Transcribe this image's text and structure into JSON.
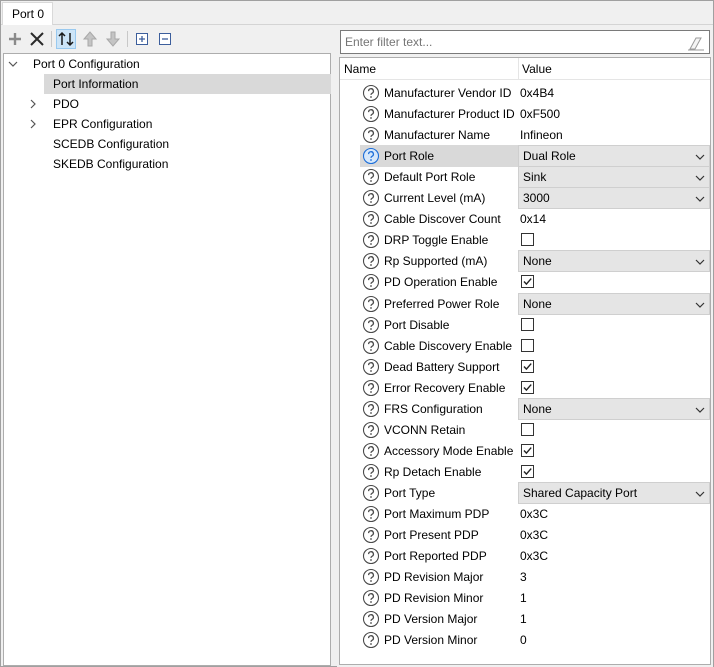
{
  "tab": {
    "label": "Port 0"
  },
  "toolbar": {
    "icons": [
      "add-icon",
      "remove-icon",
      "sort-icon",
      "move-up-icon",
      "move-down-icon",
      "expand-all-icon",
      "collapse-all-icon"
    ]
  },
  "tree": {
    "root": "Port 0 Configuration",
    "items": [
      {
        "label": "Port Information",
        "selected": true,
        "expandable": false
      },
      {
        "label": "PDO",
        "selected": false,
        "expandable": true
      },
      {
        "label": "EPR Configuration",
        "selected": false,
        "expandable": true
      },
      {
        "label": "SCEDB Configuration",
        "selected": false,
        "expandable": false
      },
      {
        "label": "SKEDB Configuration",
        "selected": false,
        "expandable": false
      }
    ]
  },
  "filter": {
    "placeholder": "Enter filter text..."
  },
  "grid": {
    "headers": {
      "name": "Name",
      "value": "Value"
    },
    "rows": [
      {
        "name": "Manufacturer Vendor ID",
        "type": "text",
        "value": "0x4B4"
      },
      {
        "name": "Manufacturer Product ID",
        "type": "text",
        "value": "0xF500"
      },
      {
        "name": "Manufacturer Name",
        "type": "text",
        "value": "Infineon"
      },
      {
        "name": "Port Role",
        "type": "combo",
        "value": "Dual Role",
        "selected": true
      },
      {
        "name": "Default Port Role",
        "type": "combo",
        "value": "Sink"
      },
      {
        "name": "Current Level (mA)",
        "type": "combo",
        "value": "3000"
      },
      {
        "name": "Cable Discover Count",
        "type": "text",
        "value": "0x14"
      },
      {
        "name": "DRP Toggle Enable",
        "type": "check",
        "checked": false
      },
      {
        "name": "Rp Supported (mA)",
        "type": "combo",
        "value": "None"
      },
      {
        "name": "PD Operation Enable",
        "type": "check",
        "checked": true
      },
      {
        "name": "Preferred Power Role",
        "type": "combo",
        "value": "None"
      },
      {
        "name": "Port Disable",
        "type": "check",
        "checked": false
      },
      {
        "name": "Cable Discovery Enable",
        "type": "check",
        "checked": false
      },
      {
        "name": "Dead Battery Support",
        "type": "check",
        "checked": true
      },
      {
        "name": "Error Recovery Enable",
        "type": "check",
        "checked": true
      },
      {
        "name": "FRS Configuration",
        "type": "combo",
        "value": "None"
      },
      {
        "name": "VCONN Retain",
        "type": "check",
        "checked": false
      },
      {
        "name": "Accessory Mode Enable",
        "type": "check",
        "checked": true
      },
      {
        "name": "Rp Detach Enable",
        "type": "check",
        "checked": true
      },
      {
        "name": "Port Type",
        "type": "combo",
        "value": "Shared Capacity Port"
      },
      {
        "name": "Port Maximum PDP",
        "type": "text",
        "value": "0x3C"
      },
      {
        "name": "Port Present PDP",
        "type": "text",
        "value": "0x3C"
      },
      {
        "name": "Port Reported PDP",
        "type": "text",
        "value": "0x3C"
      },
      {
        "name": "PD Revision Major",
        "type": "text",
        "value": "3"
      },
      {
        "name": "PD Revision Minor",
        "type": "text",
        "value": "1"
      },
      {
        "name": "PD Version Major",
        "type": "text",
        "value": "1"
      },
      {
        "name": "PD Version Minor",
        "type": "text",
        "value": "0"
      }
    ]
  },
  "colors": {
    "selection": "#d9d9d9",
    "help_icon": "#4a4a4a",
    "help_icon_selected": "#1e6fd9"
  }
}
